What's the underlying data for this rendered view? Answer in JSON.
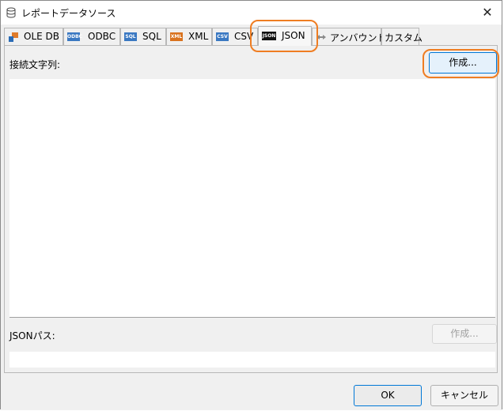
{
  "dialog": {
    "title": "レポートデータソース"
  },
  "tabs": [
    {
      "label": "OLE DB",
      "icon": "oledb-icon"
    },
    {
      "label": "ODBC",
      "icon": "odbc-icon",
      "badge": "ODBC"
    },
    {
      "label": "SQL",
      "icon": "sql-icon",
      "badge": "SQL"
    },
    {
      "label": "XML",
      "icon": "xml-icon",
      "badge": "XML"
    },
    {
      "label": "CSV",
      "icon": "csv-icon",
      "badge": "CSV"
    },
    {
      "label": "JSON",
      "icon": "json-icon",
      "badge": "JSON",
      "active": true
    },
    {
      "label": "アンバウンド",
      "icon": "unbound-icon"
    },
    {
      "label": "カスタム"
    }
  ],
  "json_tab": {
    "connection_string_label": "接続文字列:",
    "create_button_label": "作成...",
    "json_path_label": "JSONパス:",
    "path_create_button_label": "作成..."
  },
  "footer": {
    "ok_label": "OK",
    "cancel_label": "キャンセル"
  },
  "colors": {
    "highlight": "#ef7d22",
    "focus_border": "#0078d7",
    "create_button_bg": "#e5f1fb"
  }
}
